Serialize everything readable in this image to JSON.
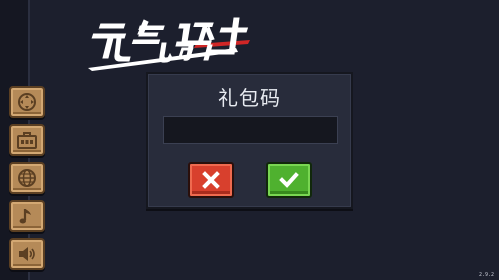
{
  "game": {
    "logo_text": "元气骑士",
    "version": "2.9.2"
  },
  "sidebar": {
    "items": [
      {
        "icon": "gamepad-icon"
      },
      {
        "icon": "tool-box-icon"
      },
      {
        "icon": "globe-icon"
      },
      {
        "icon": "music-note-icon"
      },
      {
        "icon": "speaker-icon"
      }
    ]
  },
  "gift_dialog": {
    "title": "礼包码",
    "input_value": "",
    "input_placeholder": "",
    "cancel_icon": "close-icon",
    "confirm_icon": "check-icon"
  },
  "colors": {
    "background": "#1c1f2d",
    "dialog": "#282c3b",
    "cancel": "#d8402d",
    "confirm": "#4fb12f",
    "sidebar_button": "#b58a58"
  }
}
